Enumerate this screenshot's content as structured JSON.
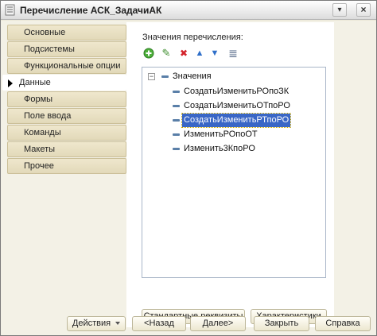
{
  "window": {
    "title": "Перечисление АСК_ЗадачиАК"
  },
  "nav": {
    "items": [
      {
        "label": "Основные",
        "active": false
      },
      {
        "label": "Подсистемы",
        "active": false
      },
      {
        "label": "Функциональные опции",
        "active": false
      },
      {
        "label": "Данные",
        "active": true
      },
      {
        "label": "Формы",
        "active": false
      },
      {
        "label": "Поле ввода",
        "active": false
      },
      {
        "label": "Команды",
        "active": false
      },
      {
        "label": "Макеты",
        "active": false
      },
      {
        "label": "Прочее",
        "active": false
      }
    ]
  },
  "panel": {
    "label": "Значения перечисления:",
    "toolbar": [
      {
        "icon": "add-icon",
        "glyph": "+",
        "color": "#3b9a2e"
      },
      {
        "icon": "edit-pencil-icon",
        "glyph": "✎",
        "color": "#3f8f2f"
      },
      {
        "icon": "delete-icon",
        "glyph": "✖",
        "color": "#d3242c"
      },
      {
        "icon": "move-up-icon",
        "glyph": "▲",
        "color": "#2f6fc9"
      },
      {
        "icon": "move-down-icon",
        "glyph": "▼",
        "color": "#2f6fc9"
      },
      {
        "icon": "sort-list-icon",
        "glyph": "≣",
        "color": "#4a5f80"
      }
    ],
    "tree": {
      "root": "Значения",
      "items": [
        {
          "label": "СоздатьИзменитьРОпоЗК",
          "selected": false
        },
        {
          "label": "СоздатьИзменитьОТпоРО",
          "selected": false
        },
        {
          "label": "СоздатьИзменитьРТпоРО",
          "selected": true
        },
        {
          "label": "ИзменитьРОпоОТ",
          "selected": false
        },
        {
          "label": "Изменить3КпоРО",
          "selected": false
        }
      ]
    },
    "buttons": {
      "standard_attrs": "Стандартные реквизиты",
      "characteristics": "Характеристики"
    }
  },
  "footer": {
    "actions": "Действия",
    "back": "<Назад",
    "next": "Далее>",
    "close": "Закрыть",
    "help": "Справка"
  },
  "colors": {
    "selection": "#3966c6",
    "nav_bg": "#e9e1c4"
  }
}
